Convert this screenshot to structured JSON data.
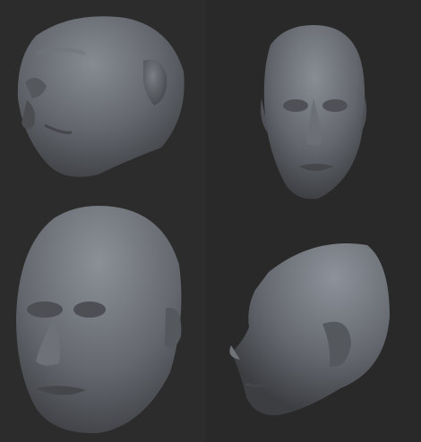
{
  "image": {
    "subject": "",
    "panels": [
      {
        "view": "three-quarter-top",
        "content": "head-render"
      },
      {
        "view": "front",
        "content": "head-render"
      },
      {
        "view": "three-quarter-front",
        "content": "head-render"
      },
      {
        "view": "side-profile",
        "content": "head-render"
      }
    ]
  },
  "colors": {
    "background_dark": "#292929",
    "background_light": "#2c2c2c",
    "clay_highlight": "#8a8f96",
    "clay_mid": "#62666c",
    "clay_shadow": "#3a3c40"
  }
}
